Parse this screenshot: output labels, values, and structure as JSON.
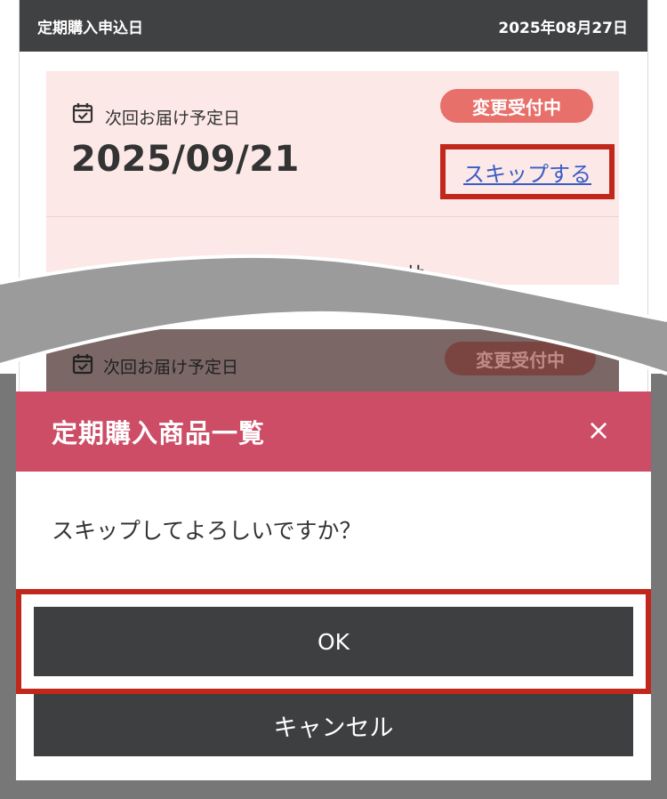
{
  "header": {
    "label": "定期購入申込日",
    "date": "2025年08月27日"
  },
  "order_card": {
    "calendar_icon": "calendar-check-icon",
    "next_delivery_label": "次回お届け予定日",
    "next_delivery_date": "2025/09/21",
    "status_badge": "変更受付中",
    "skip_link": "スキップする",
    "peek_text": "三井"
  },
  "dimmed_card": {
    "next_delivery_label": "次回お届け予定日",
    "status_badge": "変更受付中"
  },
  "modal": {
    "title": "定期購入商品一覧",
    "close_label": "×",
    "message": "スキップしてよろしいですか？",
    "ok_label": "OK",
    "cancel_label": "キャンセル"
  },
  "colors": {
    "header_bg": "#404142",
    "card_bg": "#fbe8e7",
    "badge_bg": "#e8706a",
    "link": "#3a5cc6",
    "highlight": "#c1271a",
    "modal_header": "#cd4d66",
    "button_bg": "#3d3f41"
  }
}
